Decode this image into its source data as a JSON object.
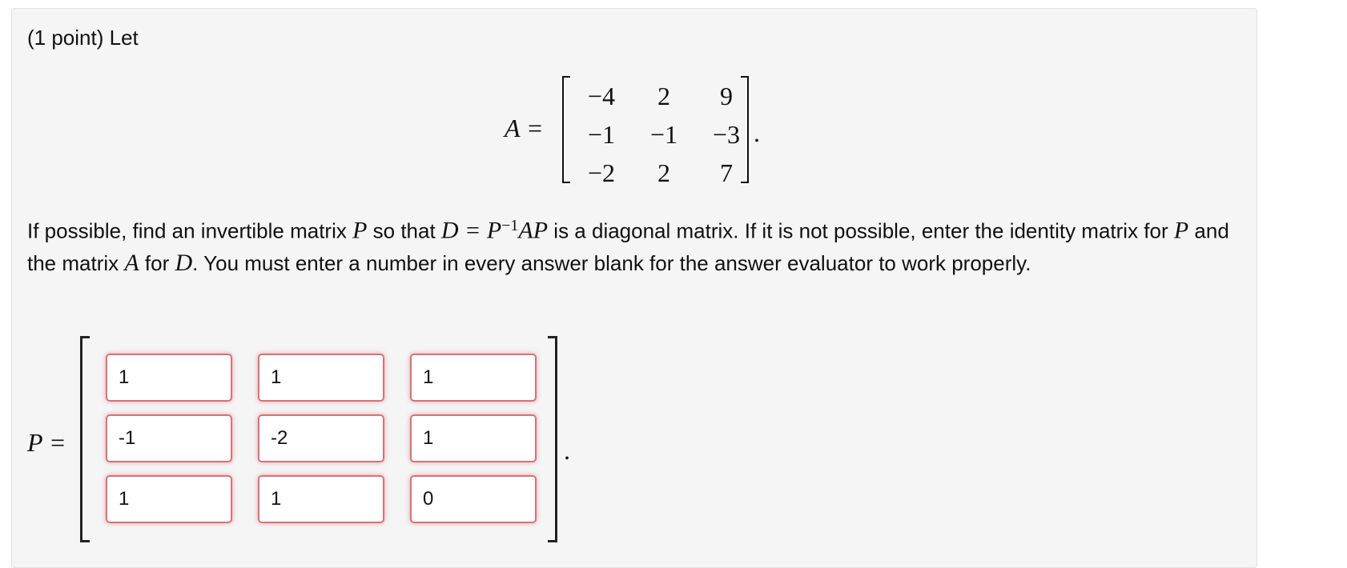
{
  "problem": {
    "intro": "(1 point) Let",
    "matrix_a": {
      "label": "A =",
      "rows": [
        [
          "−4",
          "2",
          "9"
        ],
        [
          "−1",
          "−1",
          "−3"
        ],
        [
          "−2",
          "2",
          "7"
        ]
      ],
      "end_punct": "."
    },
    "description": {
      "t1": "If possible, find an invertible matrix ",
      "m1": "P",
      "t2": " so that ",
      "m2": "D = P",
      "sup": "−1",
      "m3": "AP",
      "t3": " is a diagonal matrix. If it is not possible, enter the identity matrix for ",
      "m4": "P",
      "t4": " and the matrix ",
      "m5": "A",
      "t5": " for ",
      "m6": "D",
      "t6": ". You must enter a number in every answer blank for the answer evaluator to work properly."
    },
    "matrix_p": {
      "label": "P =",
      "values": [
        [
          "1",
          "1",
          "1"
        ],
        [
          "-1",
          "-2",
          "1"
        ],
        [
          "1",
          "1",
          "0"
        ]
      ],
      "end_punct": ".",
      "input_border_color": "#d6747a"
    }
  }
}
